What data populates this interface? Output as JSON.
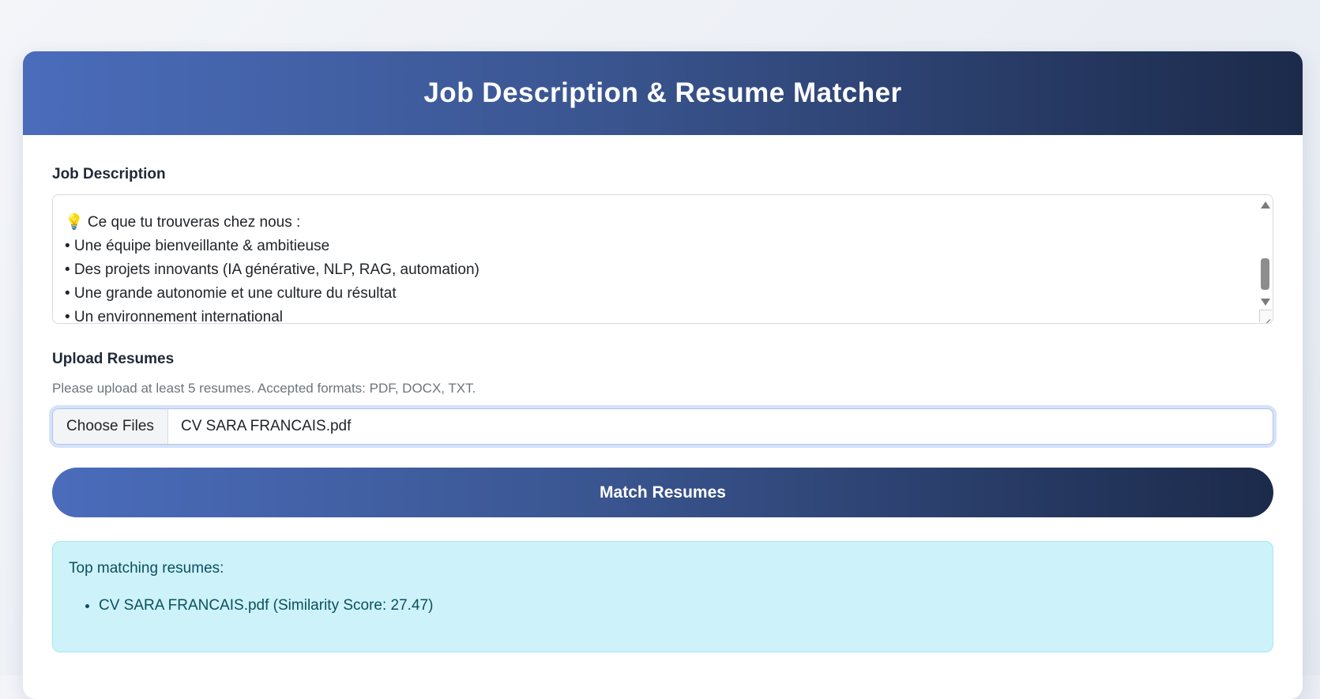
{
  "header": {
    "title": "Job Description & Resume Matcher"
  },
  "job_description": {
    "label": "Job Description",
    "visible_lines": [
      "💡  Ce que tu trouveras chez nous :",
      "• Une équipe bienveillante & ambitieuse",
      "• Des projets innovants (IA générative, NLP, RAG, automation)",
      "• Une grande autonomie et une culture du résultat",
      "• Un environnement international"
    ]
  },
  "upload": {
    "label": "Upload Resumes",
    "hint": "Please upload at least 5 resumes. Accepted formats: PDF, DOCX, TXT.",
    "choose_button": "Choose Files",
    "selected_file": "CV SARA FRANCAIS.pdf"
  },
  "actions": {
    "match_button": "Match Resumes"
  },
  "results": {
    "title": "Top matching resumes:",
    "items": [
      "CV SARA FRANCAIS.pdf (Similarity Score: 27.47)"
    ]
  },
  "colors": {
    "header_gradient_start": "#4a6cbb",
    "header_gradient_end": "#1c2a4a",
    "results_background": "#cdf2f9",
    "results_text": "#0b5060"
  }
}
